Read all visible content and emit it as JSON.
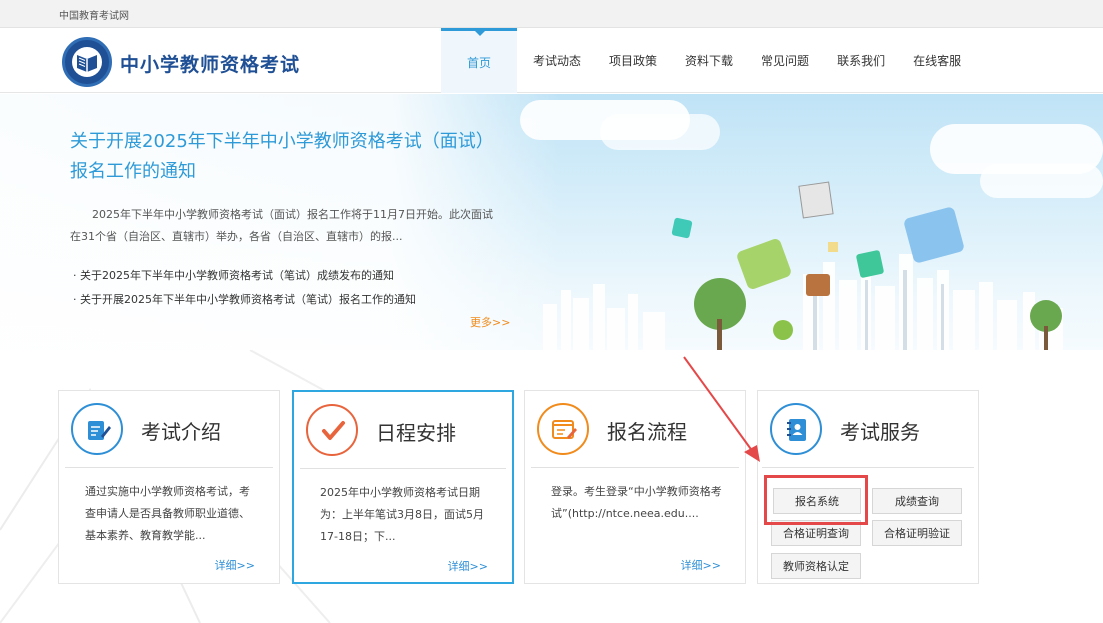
{
  "topbar": {
    "text": "中国教育考试网"
  },
  "header": {
    "site_title": "中小学教师资格考试",
    "nav": [
      "首页",
      "考试动态",
      "项目政策",
      "资料下载",
      "常见问题",
      "联系我们",
      "在线客服"
    ]
  },
  "banner": {
    "headline": "关于开展2025年下半年中小学教师资格考试（面试）报名工作的通知",
    "summary": "2025年下半年中小学教师资格考试（面试）报名工作将于11月7日开始。此次面试在31个省（自治区、直辖市）举办，各省（自治区、直辖市）的报...",
    "news": [
      "关于2025年下半年中小学教师资格考试（笔试）成绩发布的通知",
      "关于开展2025年下半年中小学教师资格考试（笔试）报名工作的通知"
    ],
    "more": "更多>>"
  },
  "cards": [
    {
      "title": "考试介绍",
      "desc": "通过实施中小学教师资格考试，考查申请人是否具备教师职业道德、基本素养、教育教学能...",
      "detail": "详细>>",
      "icon": "pencil-note-icon"
    },
    {
      "title": "日程安排",
      "desc": "2025年中小学教师资格考试日期为：上半年笔试3月8日，面试5月17-18日；下...",
      "detail": "详细>>",
      "icon": "check-icon"
    },
    {
      "title": "报名流程",
      "desc": "登录。考生登录“中小学教师资格考试”(http://ntce.neea.edu....",
      "detail": "详细>>",
      "icon": "browser-edit-icon"
    }
  ],
  "service": {
    "title": "考试服务",
    "icon": "address-book-icon",
    "buttons": [
      "报名系统",
      "成绩查询",
      "合格证明查询",
      "合格证明验证",
      "教师资格认定"
    ]
  },
  "colors": {
    "accent": "#2e9ad7",
    "brand": "#1f4f94",
    "highlight": "#e54848",
    "more": "#f08b1c"
  }
}
